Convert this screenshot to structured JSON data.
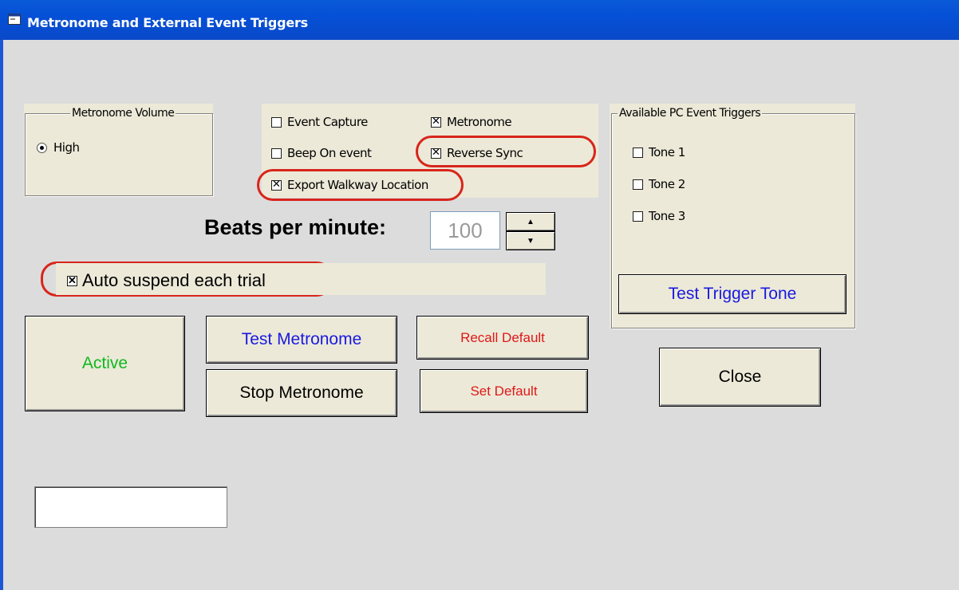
{
  "window": {
    "title": "Metronome and External Event Triggers"
  },
  "volume": {
    "legend": "Metronome Volume",
    "options": [
      {
        "label": "High",
        "selected": true
      }
    ]
  },
  "options": {
    "event_capture": {
      "label": "Event Capture",
      "checked": false
    },
    "metronome": {
      "label": "Metronome",
      "checked": true
    },
    "beep_on_event": {
      "label": "Beep On event",
      "checked": false
    },
    "reverse_sync": {
      "label": "Reverse Sync",
      "checked": true
    },
    "export_walkway": {
      "label": "Export Walkway Location",
      "checked": true
    }
  },
  "bpm": {
    "label": "Beats per minute:",
    "value": "100"
  },
  "auto_suspend": {
    "label": "Auto suspend each trial",
    "checked": true
  },
  "triggers": {
    "legend": "Available PC Event Triggers",
    "tones": [
      {
        "label": "Tone 1",
        "checked": false
      },
      {
        "label": "Tone 2",
        "checked": false
      },
      {
        "label": "Tone 3",
        "checked": false
      }
    ],
    "test_button": "Test Trigger Tone"
  },
  "buttons": {
    "active": "Active",
    "test_metronome": "Test Metronome",
    "stop_metronome": "Stop Metronome",
    "recall_default": "Recall Default",
    "set_default": "Set Default",
    "close": "Close"
  },
  "status": {
    "value": ""
  },
  "colors": {
    "active_text": "#10b820",
    "blue_text": "#1a1ae0",
    "red_text": "#e01818",
    "highlight": "#d8251b",
    "title_bar": "#0550d6"
  }
}
